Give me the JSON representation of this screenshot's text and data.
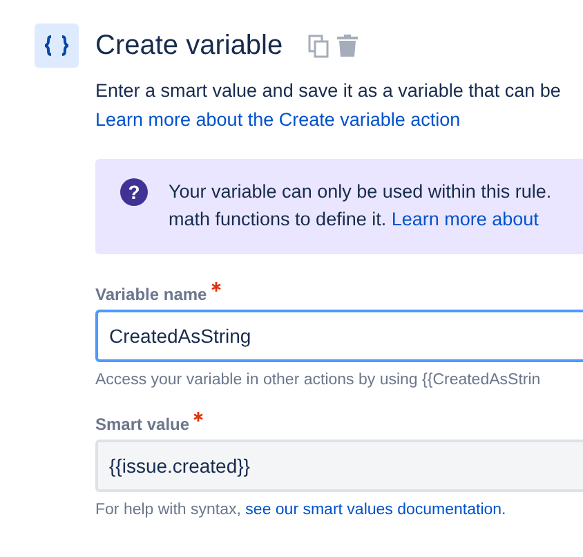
{
  "header": {
    "title": "Create variable",
    "description": "Enter a smart value and save it as a variable that can be",
    "link": "Learn more about the Create variable action"
  },
  "info": {
    "icon": "?",
    "text": "Your variable can only be used within this rule.",
    "text_2": "math functions to define it.",
    "link": "Learn more about"
  },
  "fields": [
    {
      "label": "Variable name",
      "required": true,
      "value": "CreatedAsString",
      "focused": true,
      "help": "Access your variable in other actions by using {{CreatedAsStrin"
    },
    {
      "label": "Smart value",
      "required": true,
      "value": "{{issue.created}}",
      "focused": false,
      "help": "For help with syntax,",
      "help_link": "see our smart values documentation."
    }
  ]
}
